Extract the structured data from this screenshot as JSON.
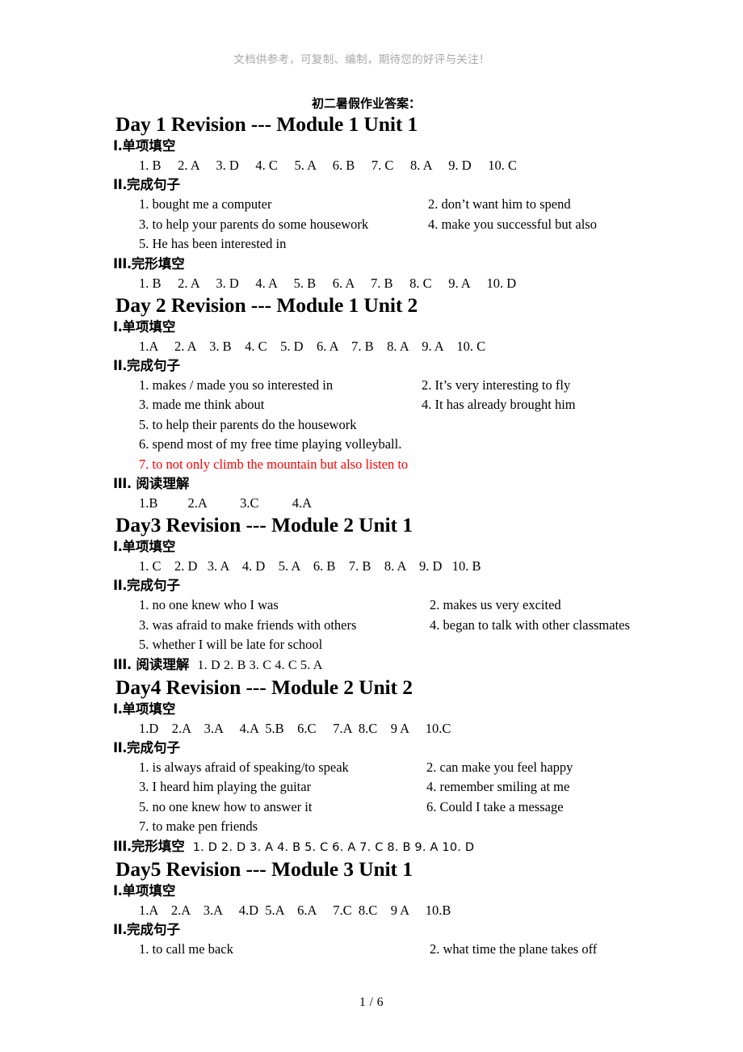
{
  "watermark": "文档供参考，可复制、编制，期待您的好评与关注！",
  "doc_title": "初二暑假作业答案：",
  "footer": "1  / 6",
  "sections": [
    {
      "day_heading": "Day 1 Revision --- Module 1 Unit 1",
      "parts": [
        {
          "roman": "I.",
          "title": "单项填空",
          "answers": "1. B     2. A     3. D     4. C     5. A     6. B     7. C     8. A     9. D     10. C"
        },
        {
          "roman": "II.",
          "title": "完成句子",
          "sentences": [
            {
              "left": "1. bought me a computer",
              "right": "2. don’t want him to spend"
            },
            {
              "left": "3. to help your parents do some housework",
              "right": "4. make you successful but also"
            },
            {
              "left": "5. He has been interested in",
              "right": ""
            }
          ]
        },
        {
          "roman": "III.",
          "title": "完形填空",
          "answers": "1. B     2. A     3. D     4. A     5. B     6. A     7. B     8. C     9. A     10. D"
        }
      ]
    },
    {
      "day_heading": "Day 2 Revision --- Module 1 Unit 2",
      "parts": [
        {
          "roman": "I.",
          "title": "单项填空",
          "answers": "1.A     2. A    3. B    4. C    5. D    6. A    7. B    8. A    9. A    10. C"
        },
        {
          "roman": "II.",
          "title": "完成句子",
          "sentences": [
            {
              "left": "1. makes / made you so interested in",
              "right": "2. It’s very interesting to fly"
            },
            {
              "left": "3. made me think about",
              "right": "4. It has already brought him"
            },
            {
              "left": "5. to help their parents do the housework",
              "right": ""
            },
            {
              "left": "6. spend most of my free time playing volleyball.",
              "right": ""
            },
            {
              "left": "7. to not only climb the mountain but also listen to",
              "right": "",
              "color": "red"
            }
          ]
        },
        {
          "roman": "III.",
          "title": "  阅读理解",
          "answers": "1.B         2.A          3.C          4.A"
        }
      ]
    },
    {
      "day_heading": "Day3 Revision --- Module 2 Unit 1",
      "parts": [
        {
          "roman": "I.",
          "title": "单项填空",
          "answers": "1. C    2. D   3. A    4. D    5. A    6. B    7. B    8. A    9. D   10. B"
        },
        {
          "roman": "II.",
          "title": "完成句子",
          "sentences": [
            {
              "left": "1. no one knew who I was",
              "right": "2. makes us very excited"
            },
            {
              "left": "3. was afraid to make friends with others",
              "right": "4. began to talk with other classmates"
            },
            {
              "left": "5. whether I will be late for school",
              "right": ""
            }
          ]
        },
        {
          "roman": "III.",
          "title": "  阅读理解",
          "inline_answers": "1. D     2. B    3. C    4. C    5. A"
        }
      ]
    },
    {
      "day_heading": "Day4 Revision --- Module 2 Unit 2",
      "parts": [
        {
          "roman": "I.",
          "title": "单项填空",
          "answers": "1.D    2.A    3.A     4.A  5.B    6.C     7.A  8.C    9 A     10.C"
        },
        {
          "roman": "II.",
          "title": "完成句子",
          "sentences": [
            {
              "left": "1. is always afraid of speaking/to speak",
              "right": "2. can make you feel happy"
            },
            {
              "left": "3. I heard him playing the guitar",
              "right": "4. remember smiling at me"
            },
            {
              "left": "5. no one knew how to answer it",
              "right": "6. Could I take a message"
            },
            {
              "left": "7. to make pen friends",
              "right": ""
            }
          ]
        },
        {
          "roman": "III.",
          "title": "完形填空",
          "inline_answers_sans": "1. D  2. D  3. A     4. B     5. C     6. A     7. C     8. B     9. A     10. D"
        }
      ]
    },
    {
      "day_heading": "Day5 Revision --- Module 3 Unit 1",
      "parts": [
        {
          "roman": "I.",
          "title": "单项填空",
          "answers": "1.A    2.A    3.A     4.D  5.A    6.A     7.C  8.C    9 A     10.B"
        },
        {
          "roman": "II.",
          "title": "完成句子",
          "sentences": [
            {
              "left": "1. to call me back",
              "right": "2. what time the plane takes off"
            }
          ]
        }
      ]
    }
  ]
}
